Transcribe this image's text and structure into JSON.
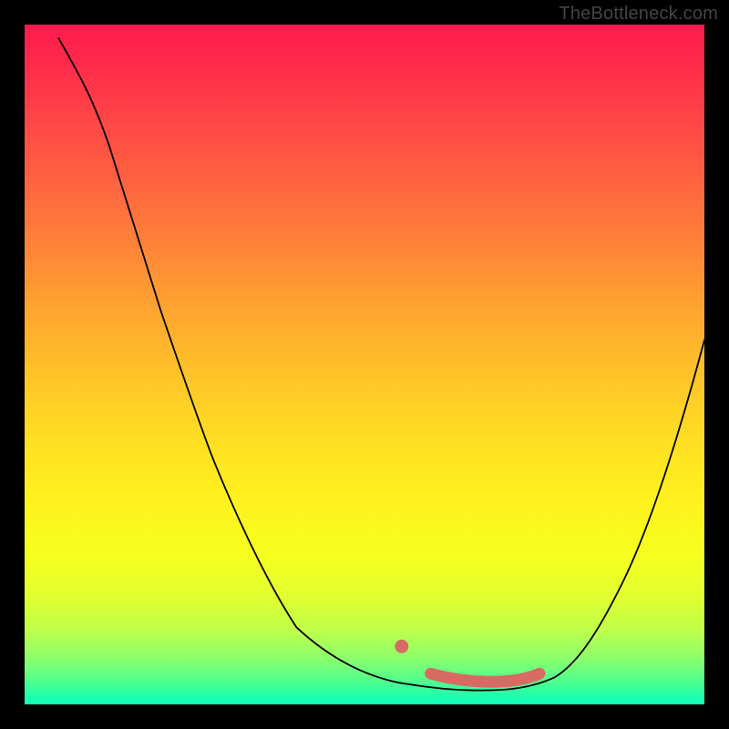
{
  "watermark": "TheBottleneck.com",
  "chart_data": {
    "type": "line",
    "title": "",
    "xlabel": "",
    "ylabel": "",
    "xlim": [
      0,
      100
    ],
    "ylim": [
      0,
      100
    ],
    "grid": false,
    "series": [
      {
        "name": "curve",
        "x": [
          5,
          10,
          15,
          20,
          25,
          30,
          35,
          40,
          45,
          50,
          55,
          57,
          60,
          63,
          66,
          69,
          72,
          76,
          80,
          84,
          88,
          92,
          96,
          100
        ],
        "y": [
          98,
          90,
          82,
          73,
          64,
          55,
          46,
          37,
          28,
          19,
          11,
          8.5,
          5.8,
          4.2,
          3.4,
          3.2,
          3.4,
          4.4,
          7.2,
          12.5,
          20.2,
          29.5,
          40.6,
          53.5
        ]
      },
      {
        "name": "highlight-flat",
        "x": [
          57,
          60,
          63,
          66,
          69,
          72,
          75
        ],
        "y": [
          4.2,
          3.6,
          3.2,
          3.1,
          3.2,
          3.5,
          4.2
        ]
      }
    ],
    "annotations": [
      {
        "name": "highlight-dot-left",
        "x": 55.5,
        "y": 8.6
      }
    ]
  }
}
